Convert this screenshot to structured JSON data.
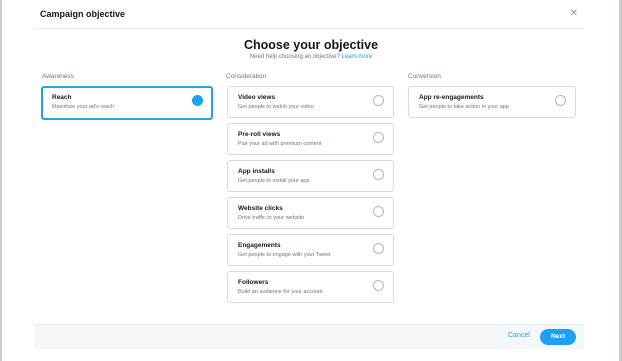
{
  "header": {
    "title": "Campaign objective",
    "close_glyph": "✕"
  },
  "main": {
    "heading": "Choose your objective",
    "help_text": "Need help choosing an objective?",
    "help_link": "Learn more"
  },
  "columns": [
    {
      "label": "Awareness",
      "options": [
        {
          "title": "Reach",
          "description": "Maximize your ad's reach",
          "selected": true
        }
      ]
    },
    {
      "label": "Consideration",
      "options": [
        {
          "title": "Video views",
          "description": "Get people to watch your video",
          "selected": false
        },
        {
          "title": "Pre-roll views",
          "description": "Pair your ad with premium content",
          "selected": false
        },
        {
          "title": "App installs",
          "description": "Get people to install your app",
          "selected": false
        },
        {
          "title": "Website clicks",
          "description": "Drive traffic to your website",
          "selected": false
        },
        {
          "title": "Engagements",
          "description": "Get people to engage with your Tweet",
          "selected": false
        },
        {
          "title": "Followers",
          "description": "Build an audience for your account",
          "selected": false
        }
      ]
    },
    {
      "label": "Conversion",
      "options": [
        {
          "title": "App re-engagements",
          "description": "Get people to take action in your app",
          "selected": false
        }
      ]
    }
  ],
  "footer": {
    "cancel_label": "Cancel",
    "next_label": "Next"
  },
  "colors": {
    "accent": "#1da1f2",
    "text": "#14171a",
    "muted": "#657786",
    "border": "#d5dbe0",
    "footer_bg": "#f5f8fa"
  }
}
